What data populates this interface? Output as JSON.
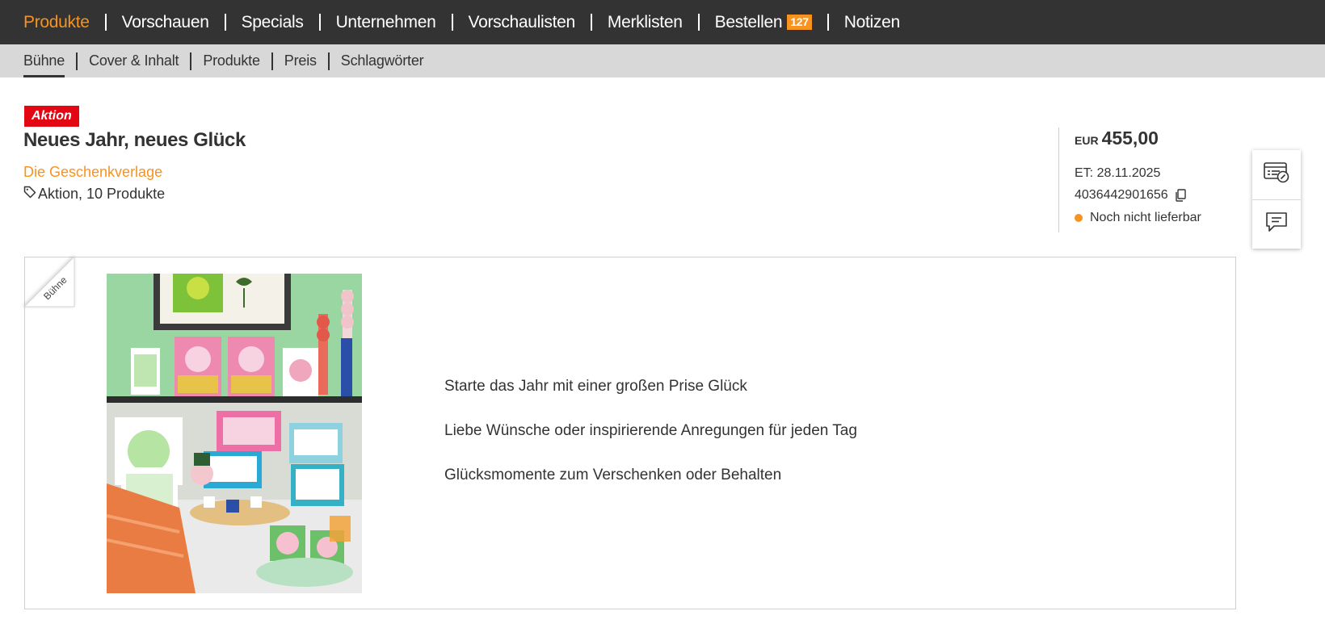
{
  "top_nav": {
    "items": [
      {
        "label": "Produkte"
      },
      {
        "label": "Vorschauen"
      },
      {
        "label": "Specials"
      },
      {
        "label": "Unternehmen"
      },
      {
        "label": "Vorschaulisten"
      },
      {
        "label": "Merklisten"
      },
      {
        "label": "Bestellen",
        "badge": "127"
      },
      {
        "label": "Notizen"
      }
    ],
    "active_color": "#f7931e"
  },
  "sub_nav": {
    "items": [
      {
        "label": "Bühne"
      },
      {
        "label": "Cover & Inhalt"
      },
      {
        "label": "Produkte"
      },
      {
        "label": "Preis"
      },
      {
        "label": "Schlagwörter"
      }
    ]
  },
  "product": {
    "badge": "Aktion",
    "title": "Neues Jahr, neues Glück",
    "publisher": "Die Geschenkverlage",
    "tag_text": "Aktion, 10 Produkte"
  },
  "price_box": {
    "currency": "EUR",
    "price": "455,00",
    "release": "ET: 28.11.2025",
    "ean": "4036442901656",
    "status": "Noch nicht lieferbar",
    "status_color": "#f7931e"
  },
  "stage": {
    "corner_label": "Bühne",
    "bullets": [
      "Starte das Jahr mit einer großen Prise Glück",
      "Liebe Wünsche oder inspirierende Anregungen für jeden Tag",
      "Glücksmomente zum Verschenken oder Behalten"
    ]
  },
  "side_actions": {
    "icons": [
      "order-list-edit-icon",
      "comment-icon"
    ]
  },
  "colors": {
    "nav_bg": "#333333",
    "subnav_bg": "#d8d8d8",
    "accent": "#f7931e",
    "badge_red": "#e30613"
  }
}
